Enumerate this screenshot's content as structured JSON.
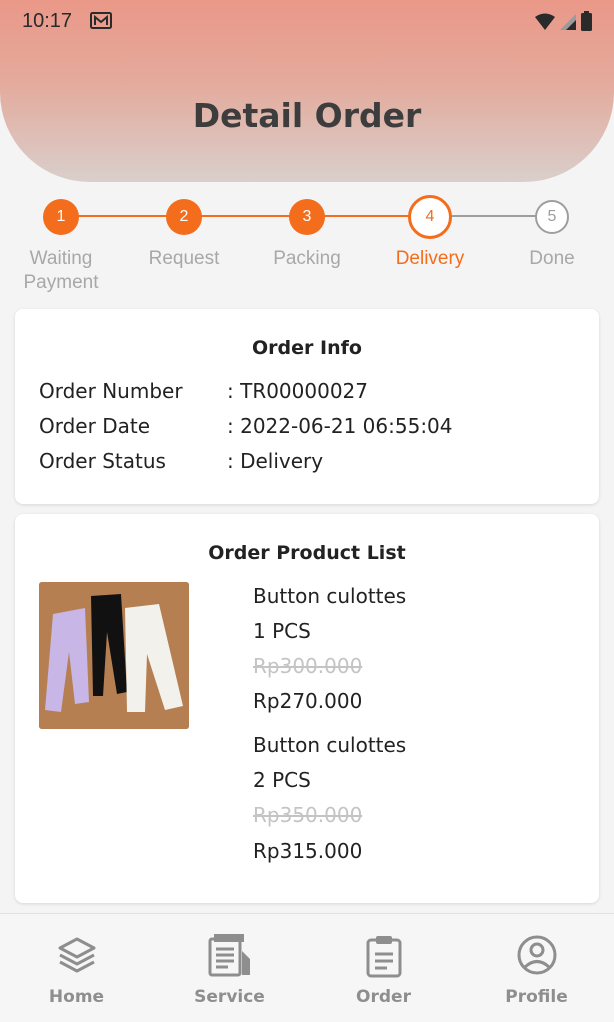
{
  "status_bar": {
    "time": "10:17"
  },
  "header": {
    "title": "Detail Order"
  },
  "stepper": {
    "steps": [
      {
        "number": "1",
        "label": "Waiting\nPayment",
        "state": "done"
      },
      {
        "number": "2",
        "label": "Request",
        "state": "done"
      },
      {
        "number": "3",
        "label": "Packing",
        "state": "done"
      },
      {
        "number": "4",
        "label": "Delivery",
        "state": "active"
      },
      {
        "number": "5",
        "label": "Done",
        "state": "pending"
      }
    ],
    "accent_color": "#f36d1c",
    "inactive_color": "#9e9e9e"
  },
  "order_info": {
    "title": "Order Info",
    "rows": [
      {
        "label": "Order Number",
        "value": ": TR00000027"
      },
      {
        "label": "Order Date",
        "value": ": 2022-06-21 06:55:04"
      },
      {
        "label": "Order Status",
        "value": ": Delivery"
      }
    ]
  },
  "product_list": {
    "title": "Order Product List",
    "items": [
      {
        "name": "Button culottes",
        "qty": "1 PCS",
        "original_price": "Rp300.000",
        "price": "Rp270.000"
      },
      {
        "name": "Button culottes",
        "qty": "2 PCS",
        "original_price": "Rp350.000",
        "price": "Rp315.000"
      }
    ]
  },
  "bottom_nav": {
    "items": [
      {
        "label": "Home",
        "icon": "layers-icon"
      },
      {
        "label": "Service",
        "icon": "service-icon"
      },
      {
        "label": "Order",
        "icon": "clipboard-icon"
      },
      {
        "label": "Profile",
        "icon": "user-circle-icon"
      }
    ]
  }
}
